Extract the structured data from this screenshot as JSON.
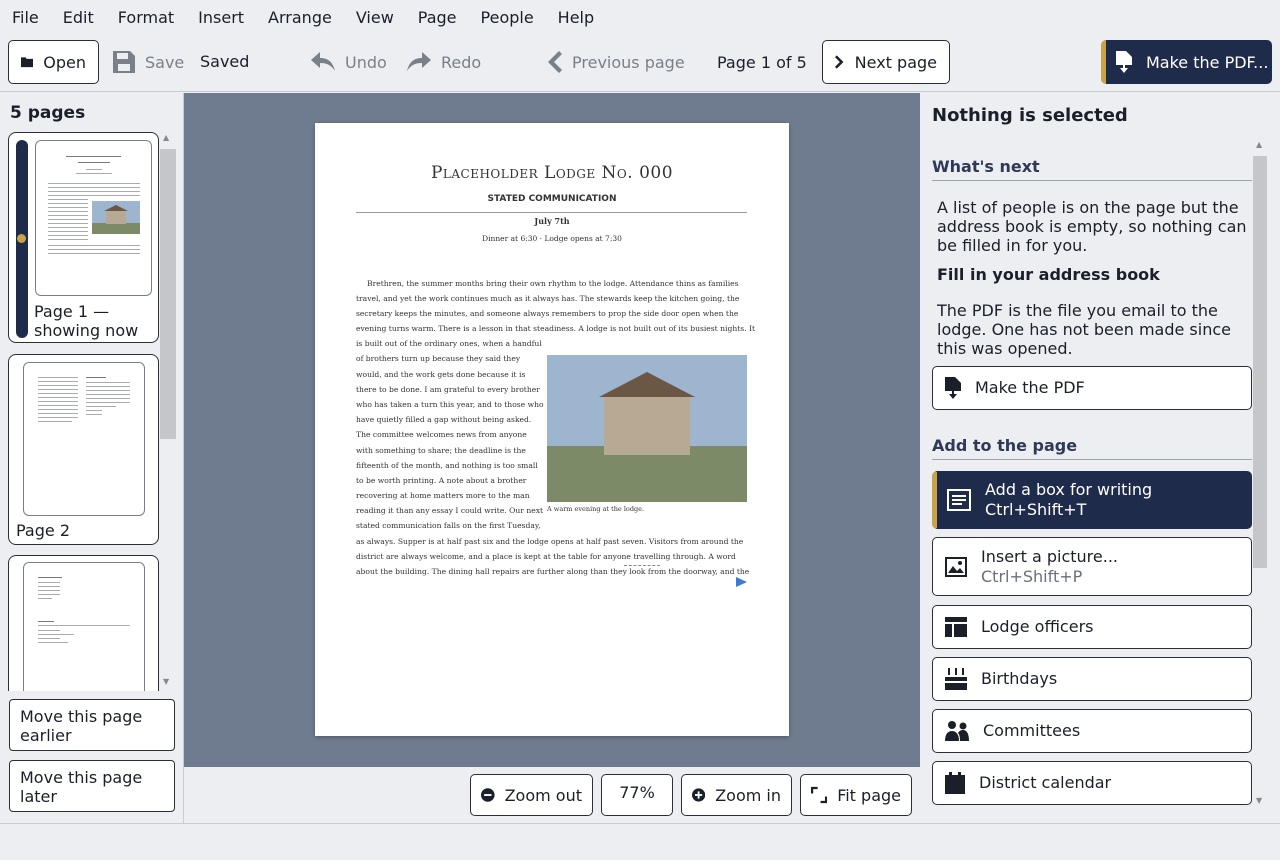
{
  "menu": [
    "File",
    "Edit",
    "Format",
    "Insert",
    "Arrange",
    "View",
    "Page",
    "People",
    "Help"
  ],
  "toolbar": {
    "open": "Open",
    "save": "Save",
    "saved_status": "Saved",
    "undo": "Undo",
    "redo": "Redo",
    "previous_page": "Previous page",
    "page_indicator": "Page 1 of 5",
    "next_page": "Next page",
    "make_pdf": "Make the PDF..."
  },
  "sidebar": {
    "heading": "5 pages",
    "pages": [
      {
        "label": "Page 1 — showing now"
      },
      {
        "label": "Page 2"
      }
    ],
    "move_earlier": "Move this page earlier",
    "move_later": "Move this page later"
  },
  "document": {
    "title": "Placeholder Lodge No. 000",
    "subtitle": "STATED COMMUNICATION",
    "date": "July 7th",
    "dinner": "Dinner at 6:30 · Lodge opens at 7:30",
    "lines_full": [
      "Brethren, the summer months bring their own rhythm to the lodge. Attendance thins as families",
      "travel, and yet the work continues much as it always has. The stewards keep the kitchen going, the",
      "secretary keeps the minutes, and someone always remembers to prop the side door open when the",
      "evening turns warm. There is a lesson in that steadiness. A lodge is not built out of its busiest nights. It"
    ],
    "lines_wrap": [
      "is built out of the ordinary ones, when a handful",
      "of brothers turn up because they said they",
      "would, and the work gets done because it is",
      "there to be done. I am grateful to every brother",
      "who has taken a turn this year, and to those who",
      "have quietly filled a gap without being asked.",
      "The committee welcomes news from anyone",
      "with something to share; the deadline is the",
      "fifteenth of the month, and nothing is too small",
      "to be worth printing. A note about a brother",
      "recovering at home matters more to the man",
      "reading it than any essay I could write. Our next",
      "stated communication falls on the first Tuesday,"
    ],
    "lines_after": [
      "as always. Supper is at half past six and the lodge opens at half past seven. Visitors from around the",
      "district are always welcome, and a place is kept at the table for anyone travelling through. A word",
      "about the building. The dining hall repairs are further along than they look from the doorway, and the"
    ],
    "caption": "A warm evening at the lodge."
  },
  "zoom": {
    "zoom_out": "Zoom out",
    "level": "77%",
    "zoom_in": "Zoom in",
    "fit_page": "Fit page"
  },
  "panel": {
    "selection_title": "Nothing is selected",
    "whats_next": "What's next",
    "msg1": "A list of people is on the page but the address book is empty, so nothing can be filled in for you.",
    "msg1_action": "Fill in your address book",
    "msg2": "The PDF is the file you email to the lodge. One has not been made since this was opened.",
    "make_pdf": "Make the PDF",
    "add_heading": "Add to the page",
    "add_text_box": "Add a box for writing",
    "add_text_box_shortcut": "Ctrl+Shift+T",
    "insert_picture": "Insert a picture...",
    "insert_picture_shortcut": "Ctrl+Shift+P",
    "lodge_officers": "Lodge officers",
    "birthdays": "Birthdays",
    "committees": "Committees",
    "district_calendar": "District calendar"
  },
  "colors": {
    "accent_navy": "#1f2b4a",
    "accent_gold": "#c9a24a",
    "canvas_bg": "#6f7b8f"
  }
}
